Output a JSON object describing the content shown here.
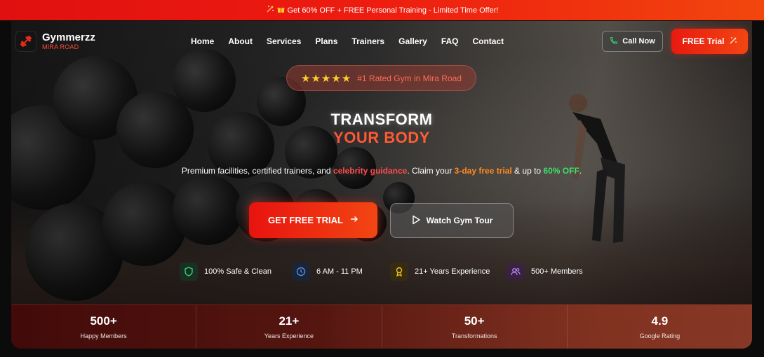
{
  "promo": {
    "text": "Get 60% OFF + FREE Personal Training - Limited Time Offer!"
  },
  "brand": {
    "name": "Gymmerzz",
    "location": "MIRA ROAD"
  },
  "nav": {
    "items": [
      "Home",
      "About",
      "Services",
      "Plans",
      "Trainers",
      "Gallery",
      "FAQ",
      "Contact"
    ]
  },
  "header": {
    "call_label": "Call Now",
    "trial_label": "FREE Trial"
  },
  "badge": {
    "stars": "★★★★★",
    "text": "#1 Rated Gym in Mira Road"
  },
  "hero": {
    "title_line1": "TRANSFORM",
    "title_line2": "YOUR BODY",
    "sub_part1": "Premium facilities, certified trainers, and ",
    "sub_hl1": "celebrity guidance",
    "sub_part2": ". Claim your ",
    "sub_hl2": "3-day free trial",
    "sub_part3": " & up to ",
    "sub_hl3": "60% OFF",
    "sub_part4": "."
  },
  "cta": {
    "primary": "GET FREE TRIAL",
    "secondary": "Watch Gym Tour"
  },
  "features": [
    {
      "label": "100% Safe & Clean",
      "icon": "shield-icon",
      "color": "#2fd37a"
    },
    {
      "label": "6 AM - 11 PM",
      "icon": "clock-icon",
      "color": "#4a8ff0"
    },
    {
      "label": "21+ Years Experience",
      "icon": "award-icon",
      "color": "#f2c21b"
    },
    {
      "label": "500+ Members",
      "icon": "users-icon",
      "color": "#b47df0"
    }
  ],
  "stats": [
    {
      "value": "500+",
      "label": "Happy Members"
    },
    {
      "value": "21+",
      "label": "Years Experience"
    },
    {
      "value": "50+",
      "label": "Transformations"
    },
    {
      "value": "4.9",
      "label": "Google Rating"
    }
  ],
  "colors": {
    "accent": "#ee1d10",
    "accent2": "#f2460d",
    "highlight_red": "#ff4b4b",
    "highlight_orange": "#ff8a1f",
    "highlight_green": "#3ee06e"
  }
}
